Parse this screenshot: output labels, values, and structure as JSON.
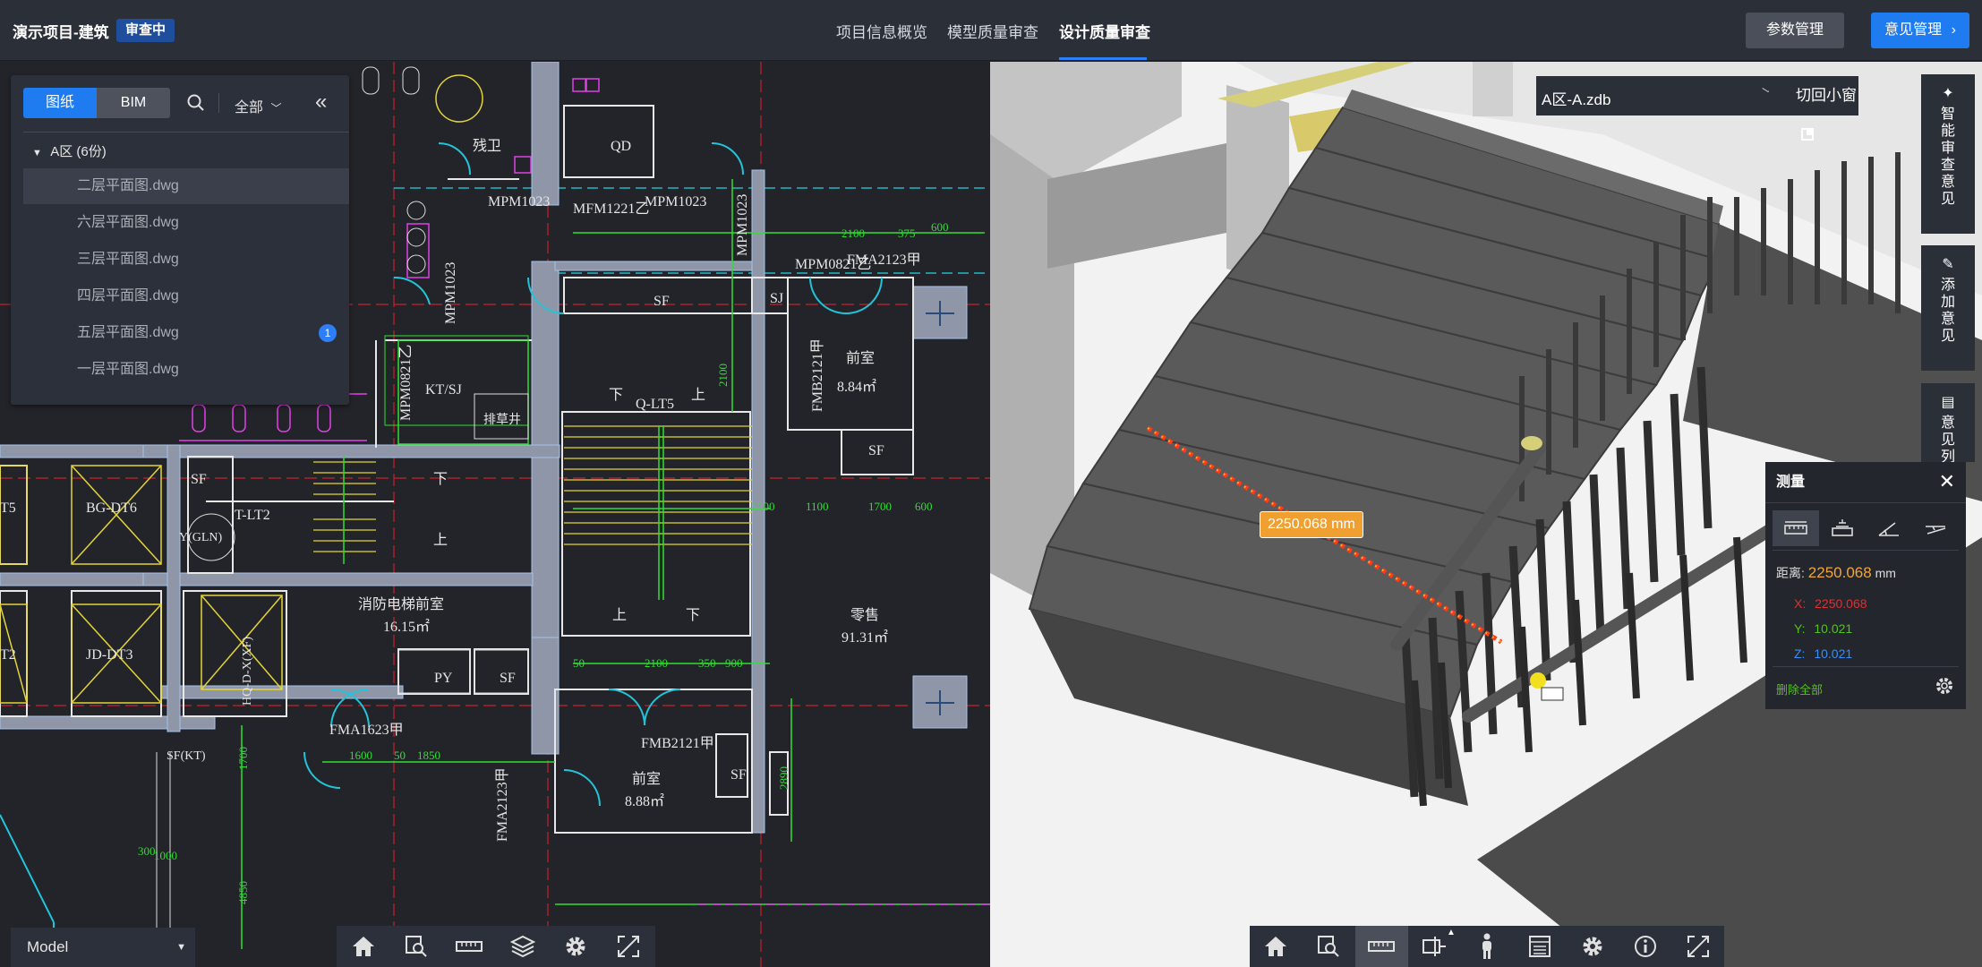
{
  "header": {
    "project_title": "演示项目-建筑",
    "status_badge": "审查中",
    "tabs": [
      {
        "label": "项目信息概览"
      },
      {
        "label": "模型质量审查"
      },
      {
        "label": "设计质量审查",
        "active": true
      }
    ],
    "param_button": "参数管理",
    "opinion_button": "意见管理",
    "opinion_chevron": "›"
  },
  "file_panel": {
    "tab_drawings": "图纸",
    "tab_bim": "BIM",
    "filter_label": "全部",
    "collapse_glyph": "«",
    "group_label": "A区 (6份)",
    "files": [
      {
        "name": "二层平面图.dwg",
        "selected": true
      },
      {
        "name": "六层平面图.dwg"
      },
      {
        "name": "三层平面图.dwg"
      },
      {
        "name": "四层平面图.dwg"
      },
      {
        "name": "五层平面图.dwg",
        "badge": "1"
      },
      {
        "name": "一层平面图.dwg"
      }
    ]
  },
  "cad": {
    "layout_select": "Model",
    "labels": {
      "wc": "残卫",
      "qd": "QD",
      "mpm1023a": "MPM1023",
      "mfm1221": "MFM1221乙",
      "mpm1023b": "MPM1023",
      "mpm0821": "MPM0821乙",
      "sf1": "SF",
      "sj": "SJ",
      "fma2123a": "FMA2123甲",
      "d2100": "2100",
      "d375": "375",
      "d600": "600",
      "kt_sj": "KT/SJ",
      "mpm0821b": "MPM0821乙",
      "pipe": "排草井",
      "fmb2121a": "FMB2121甲",
      "qianshi1": "前室",
      "area1": "8.84㎡",
      "down1": "下",
      "qlt5": "Q-LT5",
      "up1": "上",
      "sf2": "SF",
      "sf3": "SF",
      "tlt2": "T-LT2",
      "down2": "下",
      "up2": "上",
      "gl": "Y(GLN)",
      "t5": "T5",
      "bgdt6": "BG-DT6",
      "d1100a": "1100",
      "d1100b": "1100",
      "d1700": "1700",
      "d600b": "600",
      "fire_lobby": "消防电梯前室",
      "area_fire": "16.15㎡",
      "retail": "零售",
      "area_retail": "91.31㎡",
      "t2": "T2",
      "jddt3": "JD-DT3",
      "xfdt": "HQ-D-X(XF)",
      "py": "PY",
      "sf4": "SF",
      "up3": "上",
      "down3": "下",
      "d2100b": "2100",
      "d350": "350",
      "d900": "900",
      "d50": "50",
      "fma1623": "FMA1623甲",
      "d1600": "1600",
      "d50b": "50",
      "d1850": "1850",
      "fmb2121b": "FMB2121甲",
      "qianshi2": "前室",
      "area2": "8.88㎡",
      "sf5": "SF",
      "fma2123b": "FMA2123甲",
      "sfkt": "SF(KT)",
      "d1700b": "1700",
      "d1000": "1000",
      "d300": "300",
      "d4850": "4850",
      "d2890": "2890",
      "d2100c": "2100"
    }
  },
  "bim": {
    "file_name": "A区-A.zdb",
    "restore_window": "切回小窗",
    "side_buttons": [
      {
        "label": "智能审查意见"
      },
      {
        "label": "添加意见"
      },
      {
        "label": "意见列表"
      }
    ],
    "dimension_label": "2250.068 mm",
    "measure": {
      "title": "测量",
      "distance_label": "距离:",
      "distance_value": "2250.068",
      "distance_unit": "mm",
      "x_label": "X:",
      "x_value": "2250.068",
      "y_label": "Y:",
      "y_value": "10.021",
      "z_label": "Z:",
      "z_value": "10.021",
      "delete_all": "删除全部"
    }
  }
}
